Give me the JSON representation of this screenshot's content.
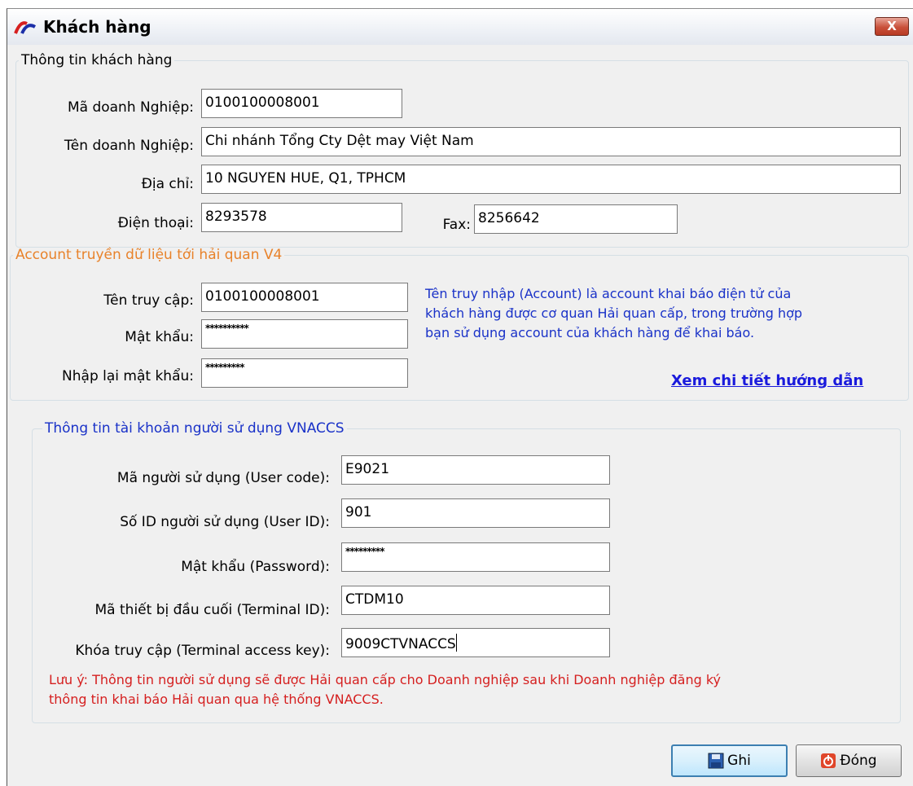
{
  "window": {
    "title": "Khách hàng",
    "close_label": "X"
  },
  "customer": {
    "legend": "Thông tin khách hàng",
    "ma_dn": {
      "label": "Mã doanh Nghiệp:",
      "value": "0100100008001"
    },
    "ten_dn": {
      "label": "Tên doanh Nghiệp:",
      "value": "Chi nhánh Tổng Cty Dệt may Việt Nam"
    },
    "dia_chi": {
      "label": "Địa chỉ:",
      "value": "10 NGUYEN HUE, Q1, TPHCM"
    },
    "dien_thoai": {
      "label": "Điện thoại:",
      "value": "8293578"
    },
    "fax": {
      "label": "Fax:",
      "value": "8256642"
    }
  },
  "account": {
    "legend": "Account truyền dữ liệu tới hải quan V4",
    "ten_truy_cap": {
      "label": "Tên truy cập:",
      "value": "0100100008001"
    },
    "mat_khau": {
      "label": "Mật khẩu:",
      "value": "**********"
    },
    "nhap_lai": {
      "label": "Nhập lại mật khẩu:",
      "value": "*********"
    },
    "info_lines": [
      "Tên truy nhập (Account) là account khai báo điện tử của",
      "khách hàng được cơ quan Hải quan cấp, trong trường hợp",
      "bạn sử dụng account của khách hàng để khai báo."
    ],
    "help_link": "Xem chi tiết hướng dẫn"
  },
  "vnaccs": {
    "legend": "Thông tin tài khoản người sử dụng VNACCS",
    "user_code": {
      "label": "Mã người sử dụng (User code):",
      "value": "E9021"
    },
    "user_id": {
      "label": "Số ID người sử dụng (User ID):",
      "value": "901"
    },
    "password": {
      "label": "Mật khẩu (Password):",
      "value": "*********"
    },
    "terminal_id": {
      "label": "Mã thiết bị đầu cuối (Terminal ID):",
      "value": "CTDM10"
    },
    "access_key": {
      "label": "Khóa truy cập (Terminal access key):",
      "value": "9009CTVNACCS"
    },
    "note_lines": [
      "Lưu ý: Thông tin người sử dụng sẽ được Hải quan cấp cho Doanh nghiệp sau khi Doanh nghiệp đăng ký",
      "thông tin khai báo Hải quan qua hệ thống VNACCS."
    ]
  },
  "buttons": {
    "save": "Ghi",
    "close": "Đóng"
  },
  "colors": {
    "legend_orange": "#e8822a",
    "legend_blue": "#1a32c8",
    "note_red": "#d51f1f",
    "link_blue": "#1a1adc"
  }
}
